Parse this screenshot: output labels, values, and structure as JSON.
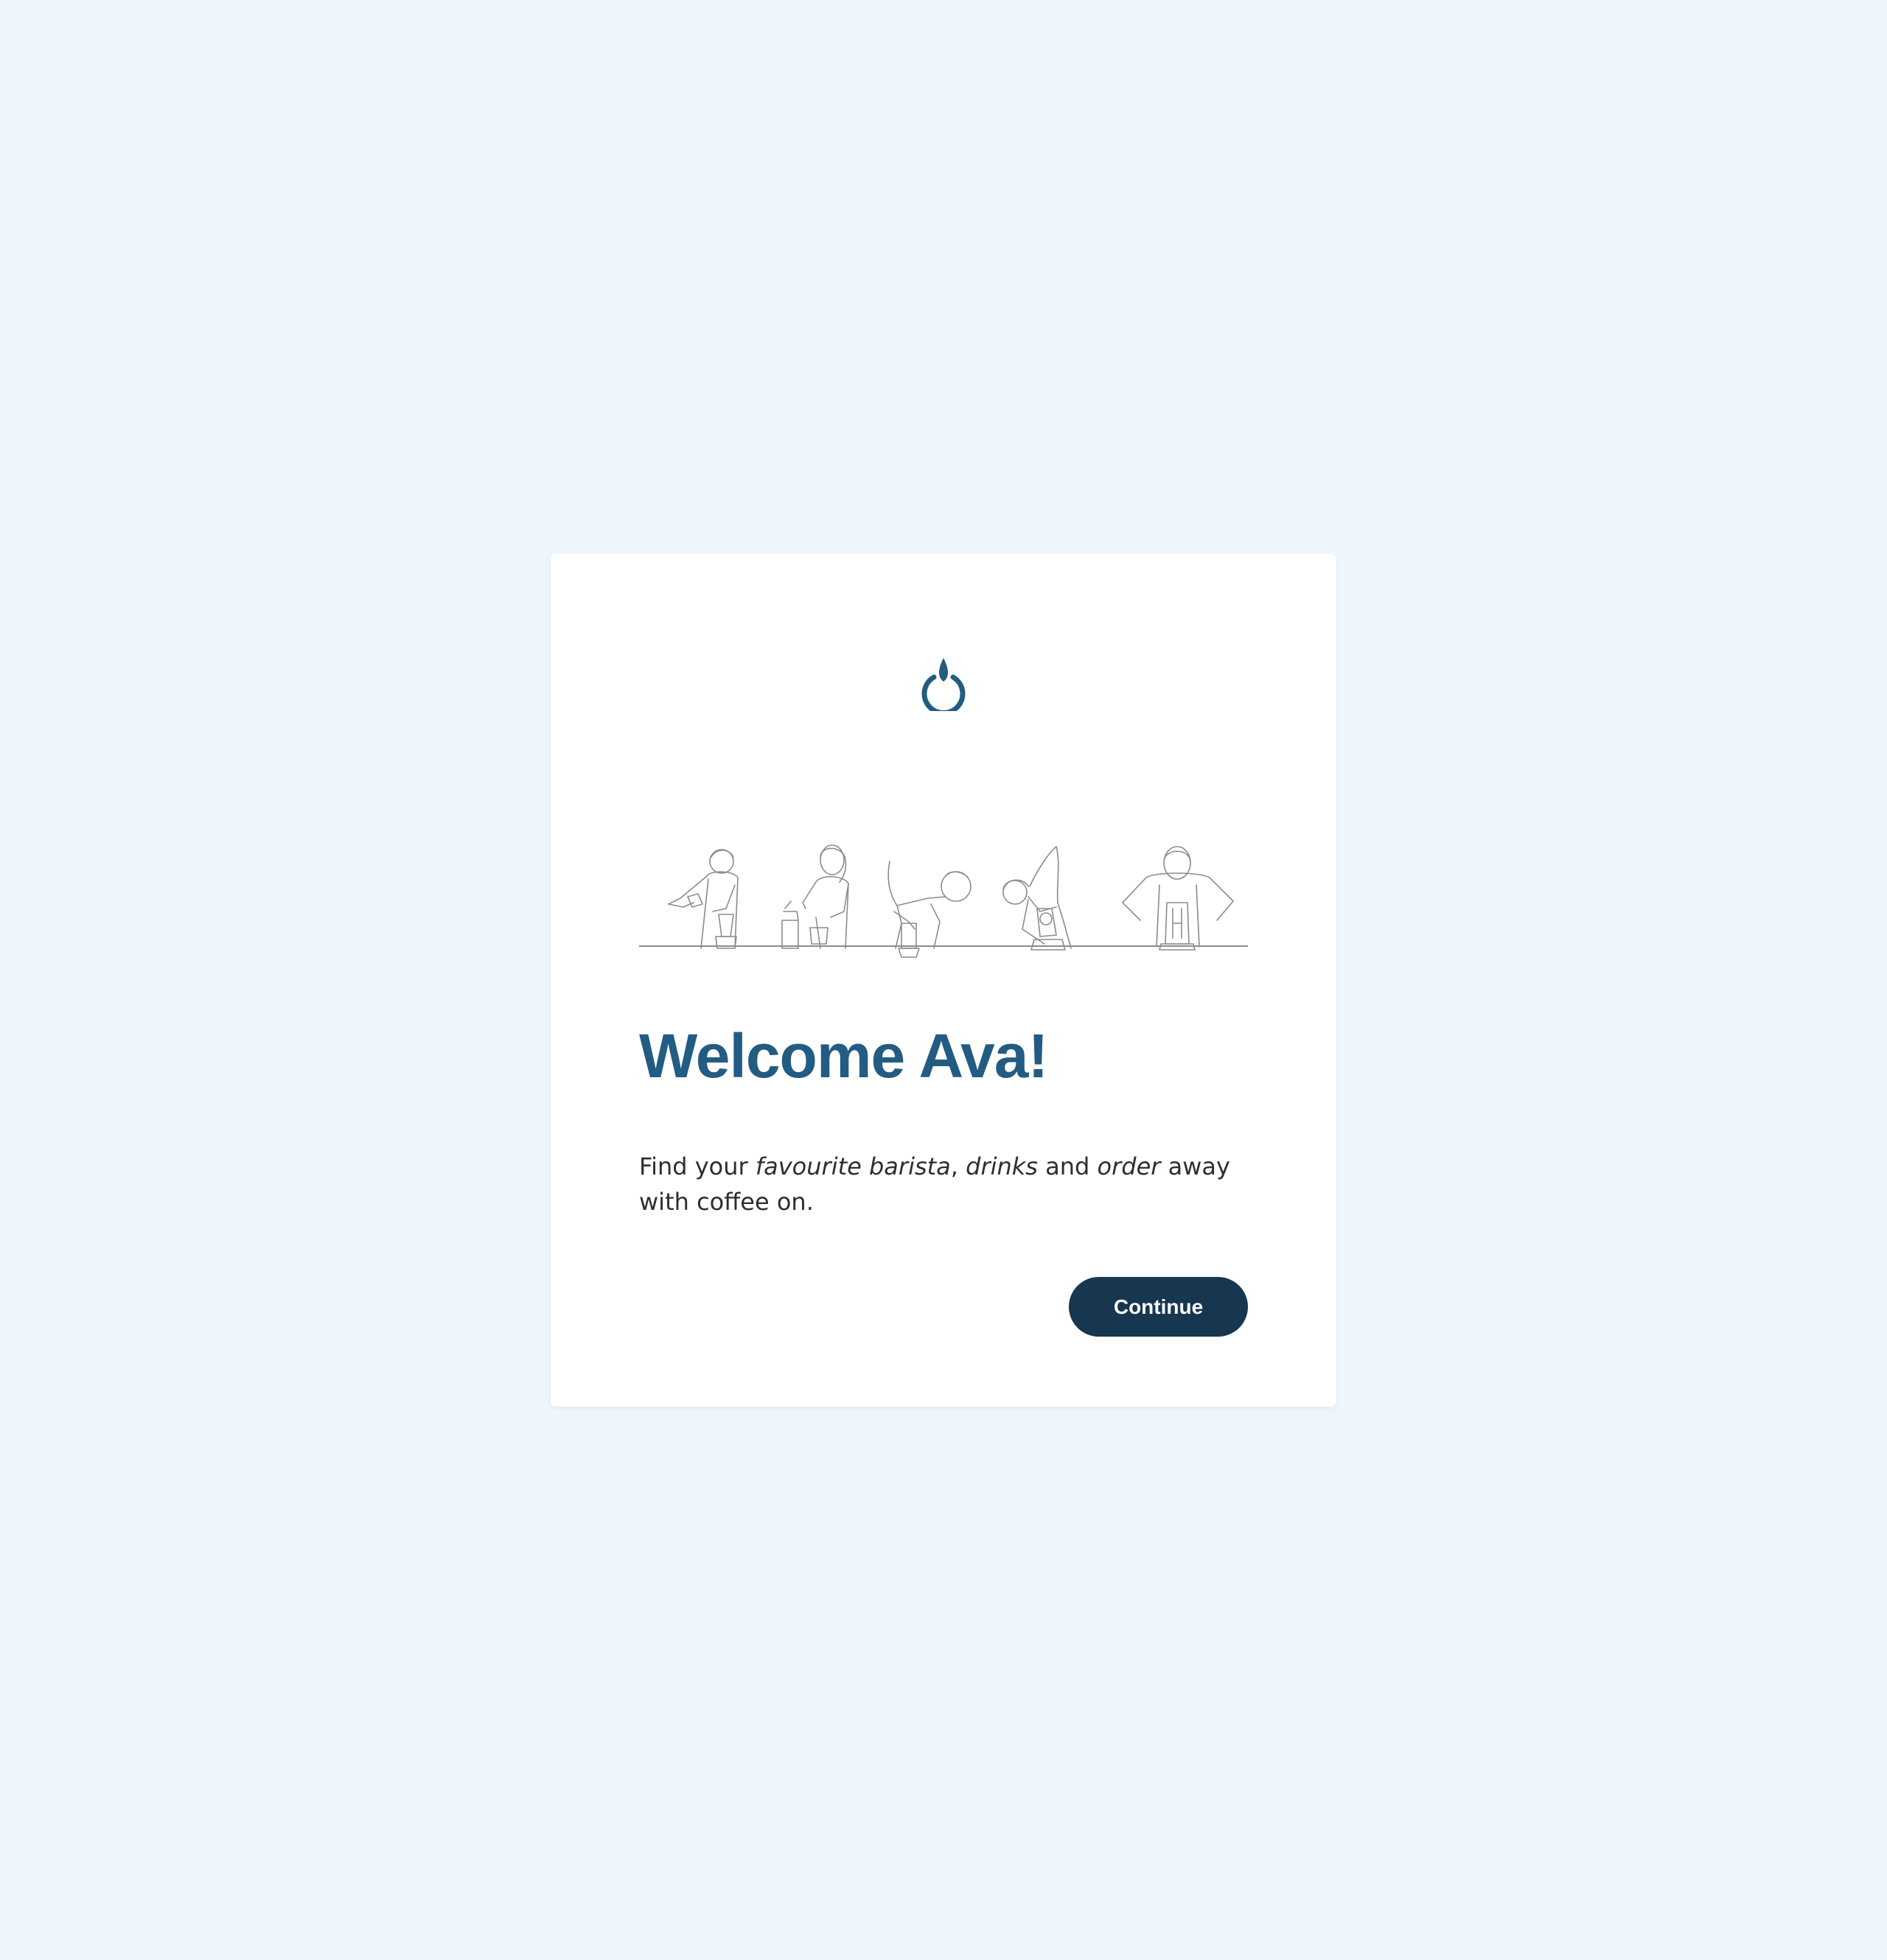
{
  "colors": {
    "page_background": "#eef5fd",
    "card_background": "#ffffff",
    "title_color": "#235c82",
    "logo_color": "#235c82",
    "button_background": "#173650",
    "button_text": "#ffffff",
    "illustration_stroke": "#8c8c8c"
  },
  "logo": {
    "icon": "coffee-drop-power-icon"
  },
  "illustration": {
    "icon": "baristas-line-drawing"
  },
  "welcome": {
    "title": "Welcome Ava!",
    "desc_part1": "Find your ",
    "desc_em1": "favourite barista",
    "desc_part2": ", ",
    "desc_em2": "drinks",
    "desc_part3": " and ",
    "desc_em3": "order",
    "desc_part4": " away with coffee on."
  },
  "actions": {
    "continue_label": "Continue"
  }
}
